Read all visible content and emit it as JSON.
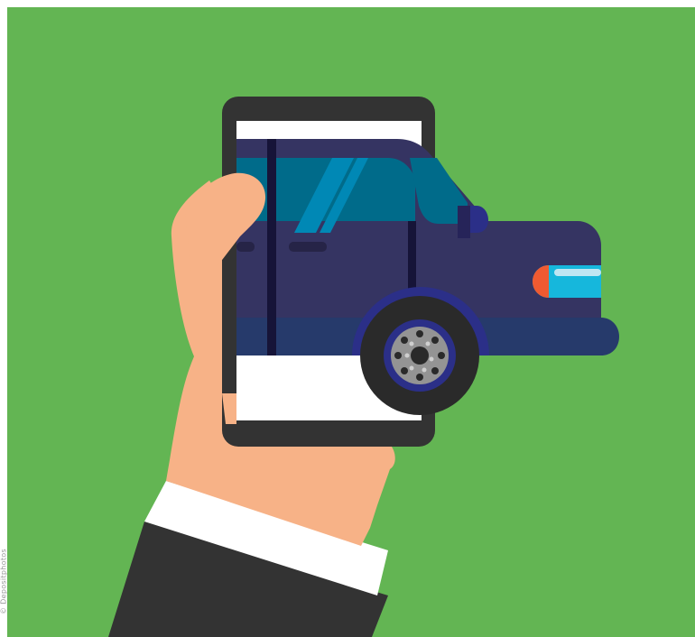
{
  "credit": "© Depositphotos",
  "colors": {
    "background": "#63b553",
    "hand": "#f7b287",
    "cuff": "#ffffff",
    "sleeve": "#333333",
    "phone_frame": "#333333",
    "phone_screen": "#ffffff",
    "car_body": "#353462",
    "car_lower": "#263a6b",
    "window": "#006b8a",
    "window_glare": "#0088b5",
    "tire": "#2a2a2a",
    "rim": "#949494",
    "rim_ring": "#2b2f88",
    "headlight": "#16b7dc",
    "indicator": "#ef5a31"
  }
}
